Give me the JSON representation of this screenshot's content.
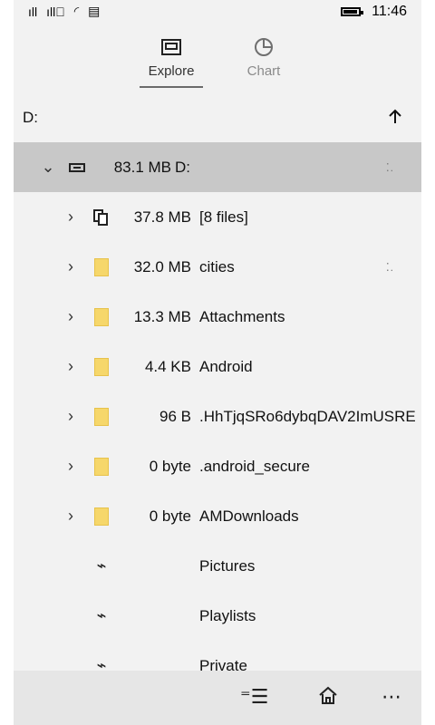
{
  "status": {
    "time": "11:46"
  },
  "tabs": [
    {
      "label": "Explore"
    },
    {
      "label": "Chart"
    }
  ],
  "path": {
    "current": "D:"
  },
  "rows": [
    {
      "size": "83.1 MB",
      "name": "D:"
    },
    {
      "size": "37.8 MB",
      "name": "[8 files]"
    },
    {
      "size": "32.0 MB",
      "name": "cities"
    },
    {
      "size": "13.3 MB",
      "name": "Attachments"
    },
    {
      "size": "4.4 KB",
      "name": "Android"
    },
    {
      "size": "96 B",
      "name": ".HhTjqSRo6dybqDAV2ImUSRE"
    },
    {
      "size": "0 byte",
      "name": ".android_secure"
    },
    {
      "size": "0 byte",
      "name": "AMDownloads"
    },
    {
      "size": "",
      "name": "Pictures"
    },
    {
      "size": "",
      "name": "Playlists"
    },
    {
      "size": "",
      "name": "Private"
    }
  ]
}
